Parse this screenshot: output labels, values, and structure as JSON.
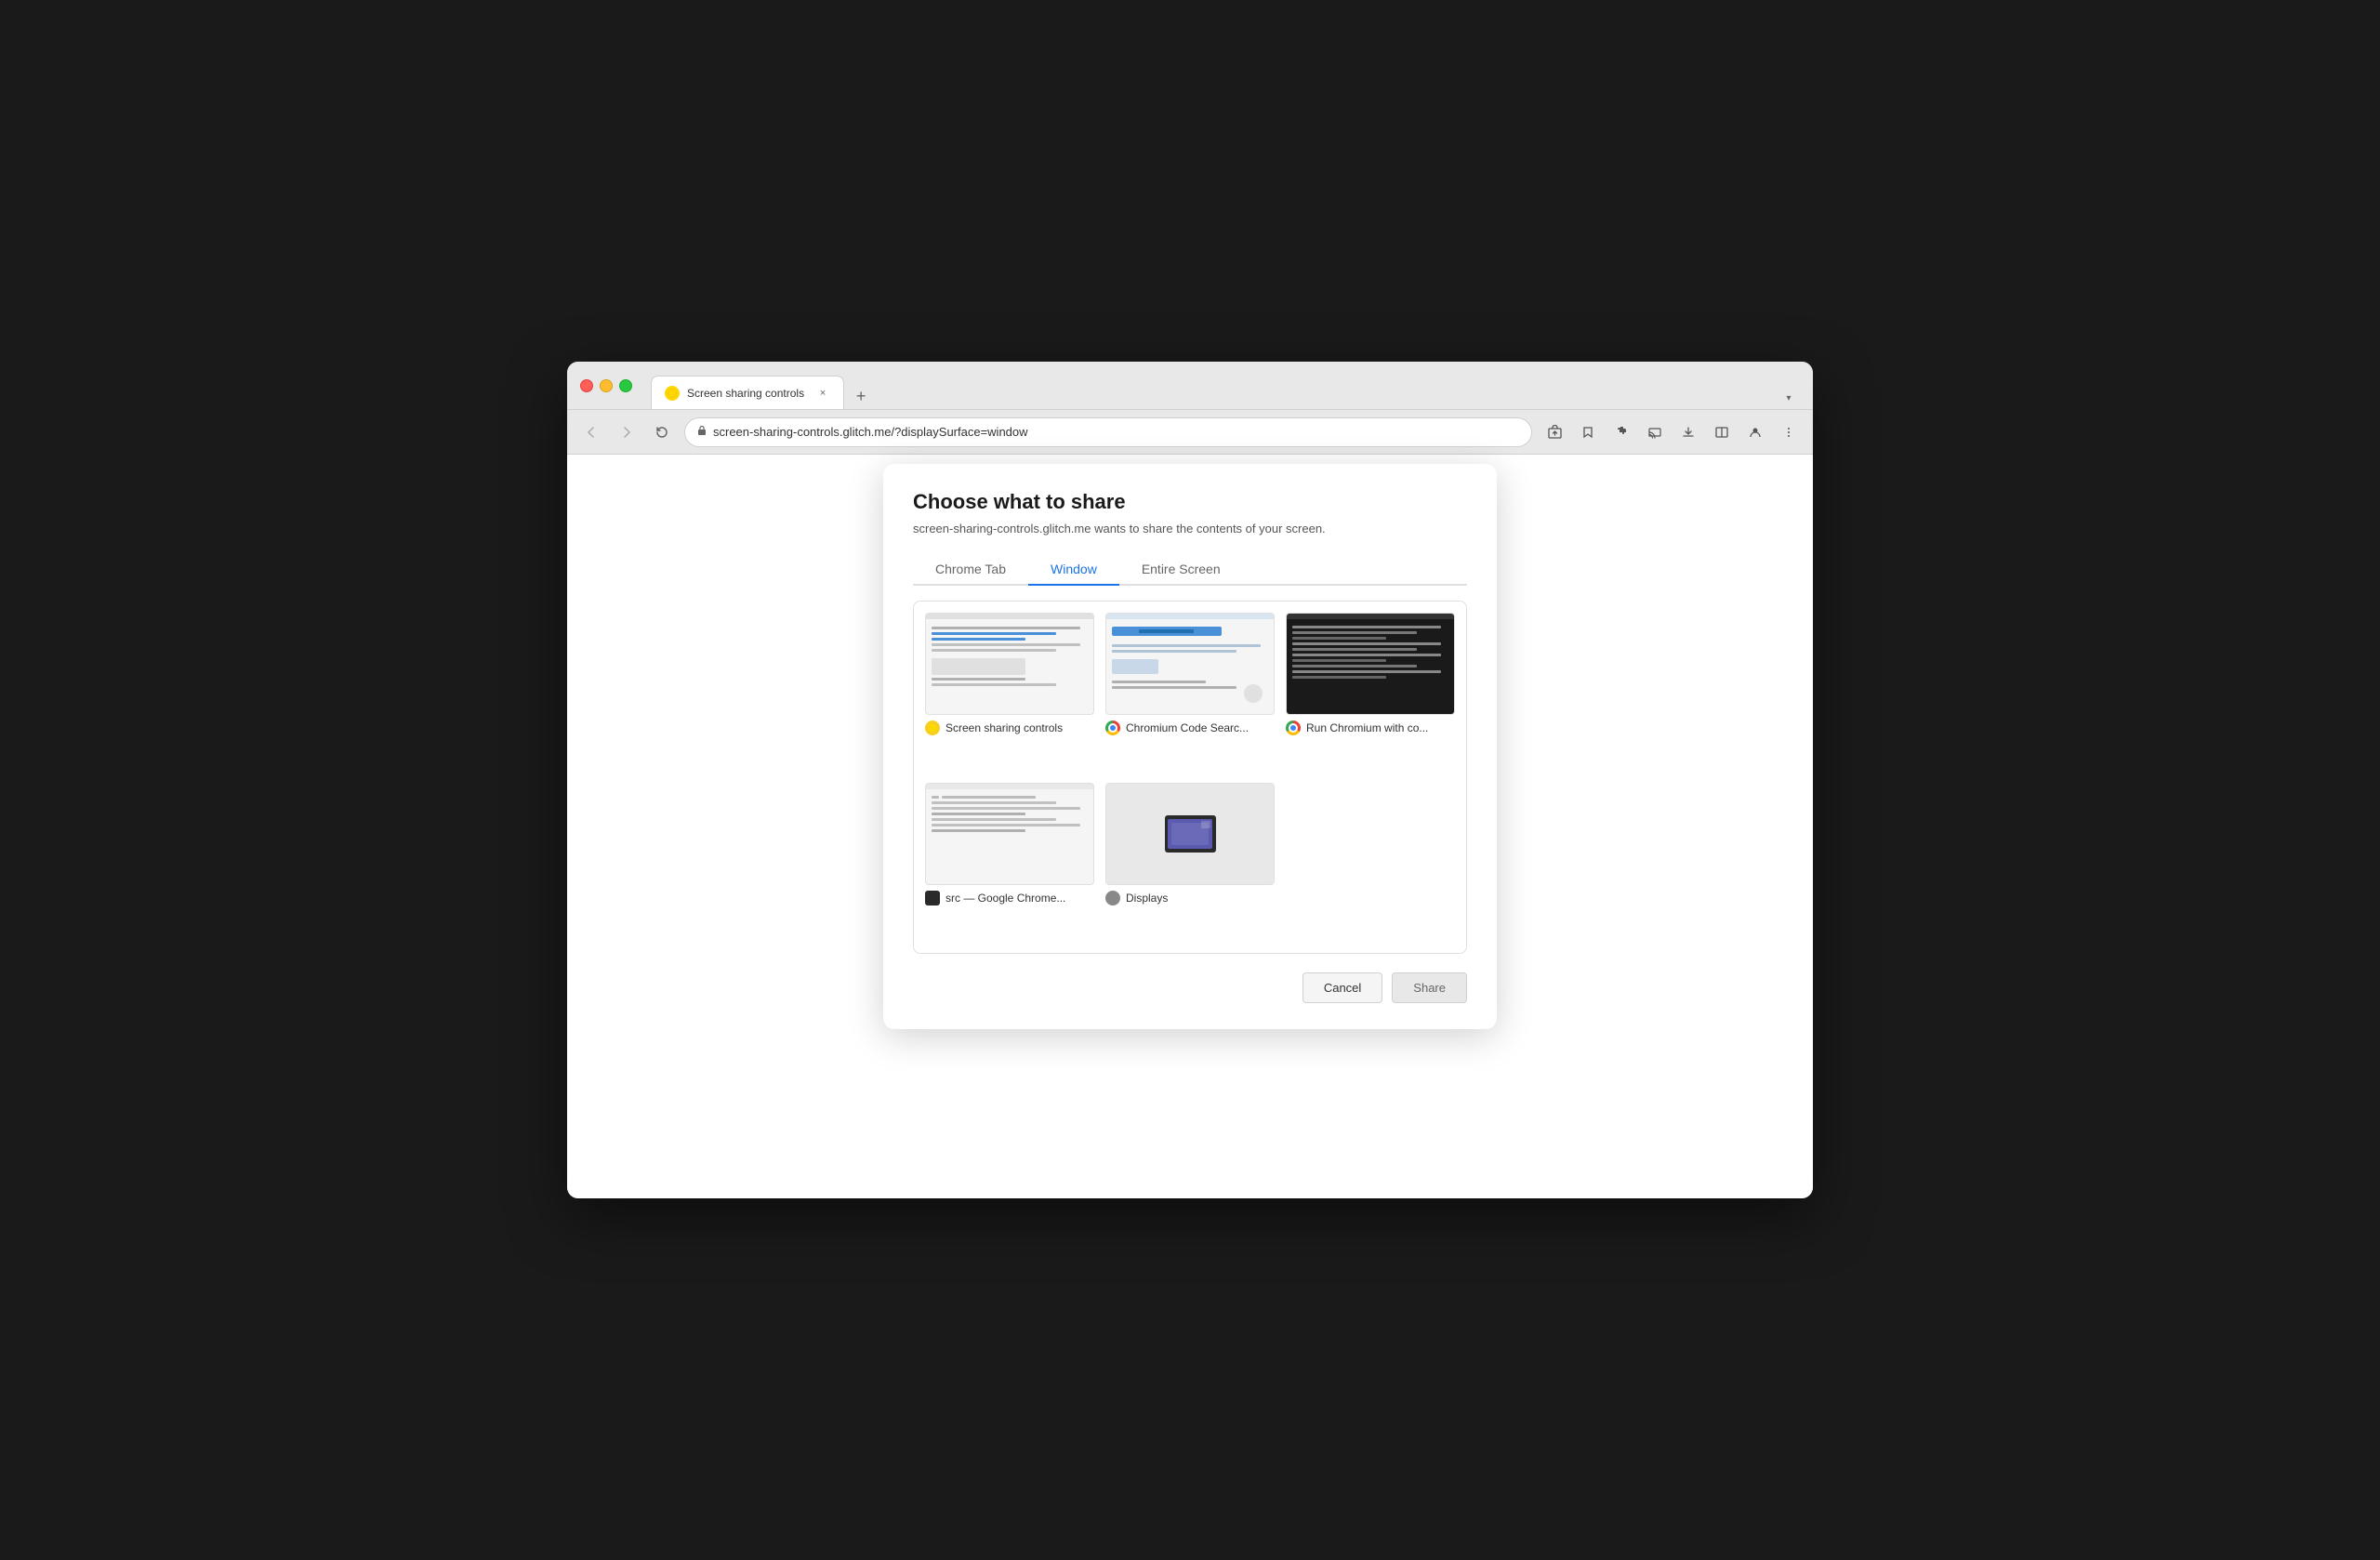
{
  "browser": {
    "tab_title": "Screen sharing controls",
    "tab_close": "×",
    "tab_new": "+",
    "address": "screen-sharing-controls.glitch.me/?displaySurface=window",
    "tab_list_label": "▾"
  },
  "dialog": {
    "title": "Choose what to share",
    "subtitle": "screen-sharing-controls.glitch.me wants to share the contents of your screen.",
    "tabs": [
      {
        "id": "chrome-tab",
        "label": "Chrome Tab",
        "active": false
      },
      {
        "id": "window",
        "label": "Window",
        "active": true
      },
      {
        "id": "entire-screen",
        "label": "Entire Screen",
        "active": false
      }
    ],
    "windows": [
      {
        "id": "window-1",
        "name": "Screen sharing controls",
        "favicon_type": "screen"
      },
      {
        "id": "window-2",
        "name": "Chromium Code Searc...",
        "favicon_type": "chrome"
      },
      {
        "id": "window-3",
        "name": "Run Chromium with co...",
        "favicon_type": "chrome"
      },
      {
        "id": "window-4",
        "name": "src — Google Chrome...",
        "favicon_type": "black"
      },
      {
        "id": "window-5",
        "name": "Displays",
        "favicon_type": "displays"
      }
    ],
    "cancel_label": "Cancel",
    "share_label": "Share"
  }
}
